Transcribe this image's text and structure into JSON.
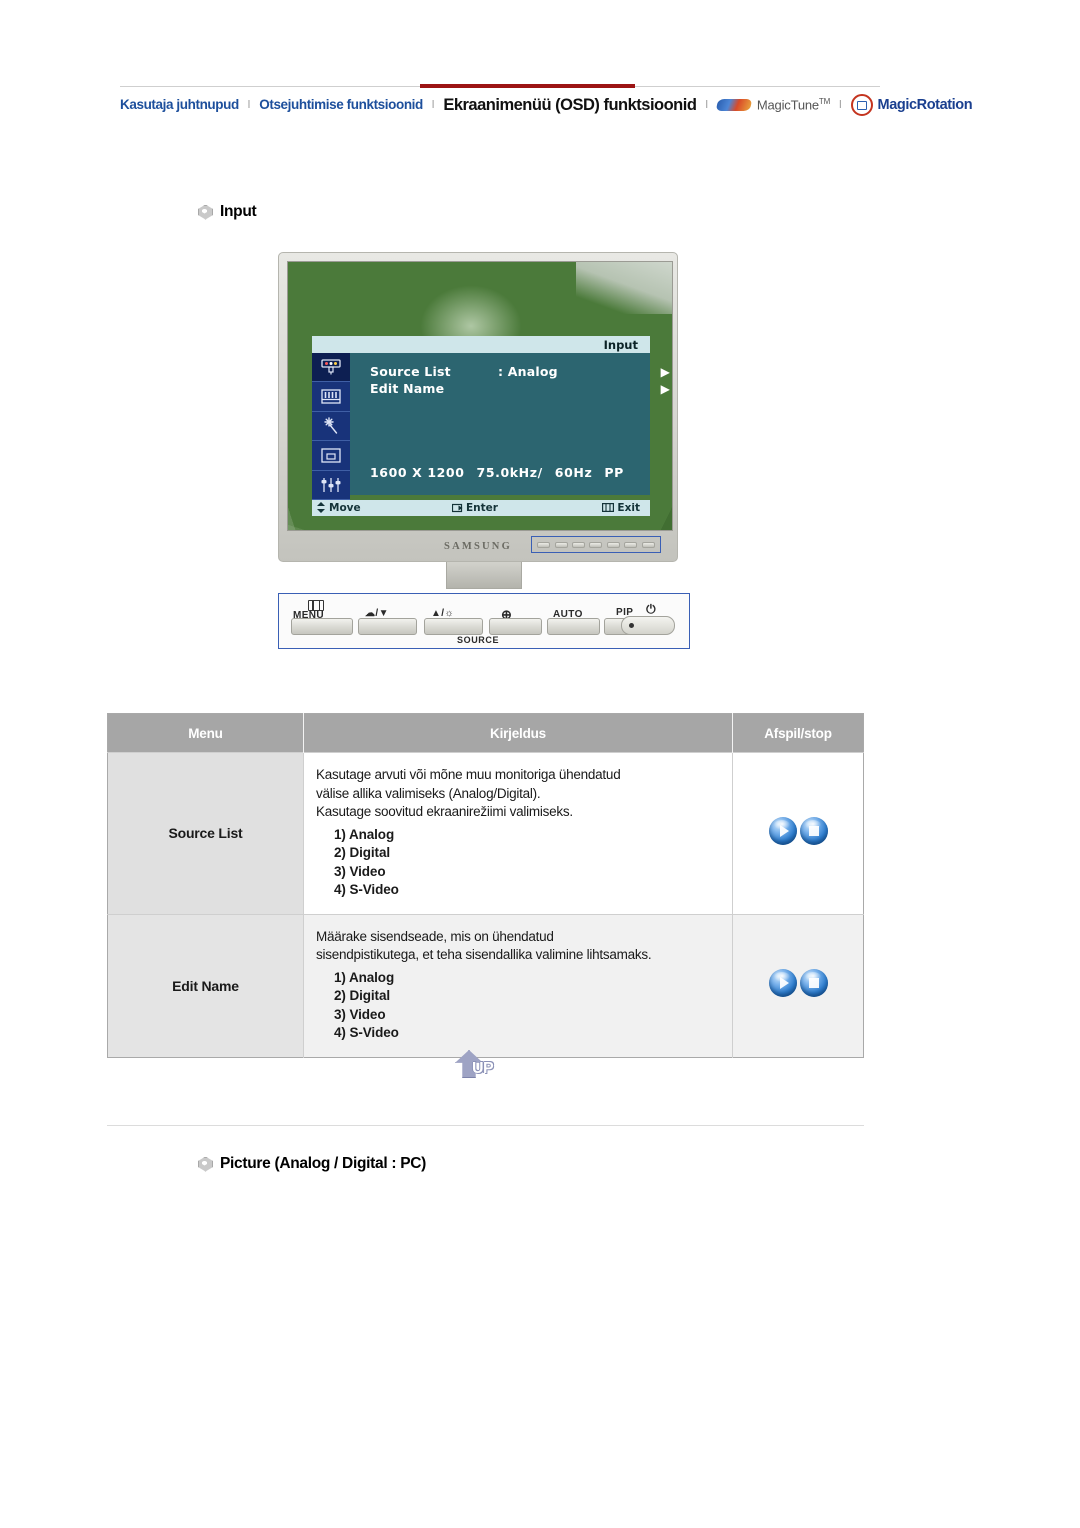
{
  "topnav": {
    "links": [
      {
        "label": "Kasutaja juhtnupud",
        "style": "blue"
      },
      {
        "label": "Otsejuhtimise funktsioonid",
        "style": "blue"
      }
    ],
    "current": "Ekraanimenüü (OSD) funktsioonid",
    "magictune": "MagicTune",
    "magictune_tm": "TM",
    "magicrotation": "MagicRotation",
    "separator": "l"
  },
  "headings": {
    "input": "Input",
    "picture": "Picture (Analog / Digital : PC)"
  },
  "monitor": {
    "brand": "SAMSUNG",
    "osd": {
      "title": "Input",
      "rows": [
        {
          "label": "Source List",
          "value": ": Analog",
          "arrow": "▶"
        },
        {
          "label": "Edit Name",
          "value": "",
          "arrow": "▶"
        }
      ],
      "resolution": "1600 X 1200",
      "frequency": "75.0kHz/",
      "refresh": "60Hz",
      "polarity": "PP",
      "footer": {
        "move": "Move",
        "enter": "Enter",
        "exit": "Exit"
      }
    },
    "controls": {
      "menu": "MENU",
      "down": "/▼",
      "up": "▲/",
      "source_icon": "⊕",
      "auto": "AUTO",
      "pip": "PIP",
      "source": "SOURCE",
      "power": "⏻"
    }
  },
  "table": {
    "headers": [
      "Menu",
      "Kirjeldus",
      "Afspil/stop"
    ],
    "rows": [
      {
        "menu": "Source List",
        "description": [
          "Kasutage arvuti või mõne muu monitoriga ühendatud",
          "välise allika valimiseks (Analog/Digital).",
          "Kasutage soovitud ekraanirežiimi valimiseks."
        ],
        "options": [
          "1) Analog",
          "2) Digital",
          "3) Video",
          "4) S-Video"
        ]
      },
      {
        "menu": "Edit Name",
        "description": [
          "Määrake sisendseade, mis on ühendatud",
          "sisendpistikutega, et teha sisendallika valimine lihtsamaks."
        ],
        "options": [
          "1) Analog",
          "2) Digital",
          "3) Video",
          "4) S-Video"
        ]
      }
    ]
  },
  "up_button": {
    "label": "UP"
  },
  "colors": {
    "nav_blue": "#1d4f9c",
    "nav_red": "#9c1414",
    "osd_teal": "#2c6570",
    "osd_bar": "#cfe6ea",
    "osd_sidebar": "#18337a",
    "table_header": "#a6a6a6",
    "orb_blue": "#2f7fd0"
  }
}
